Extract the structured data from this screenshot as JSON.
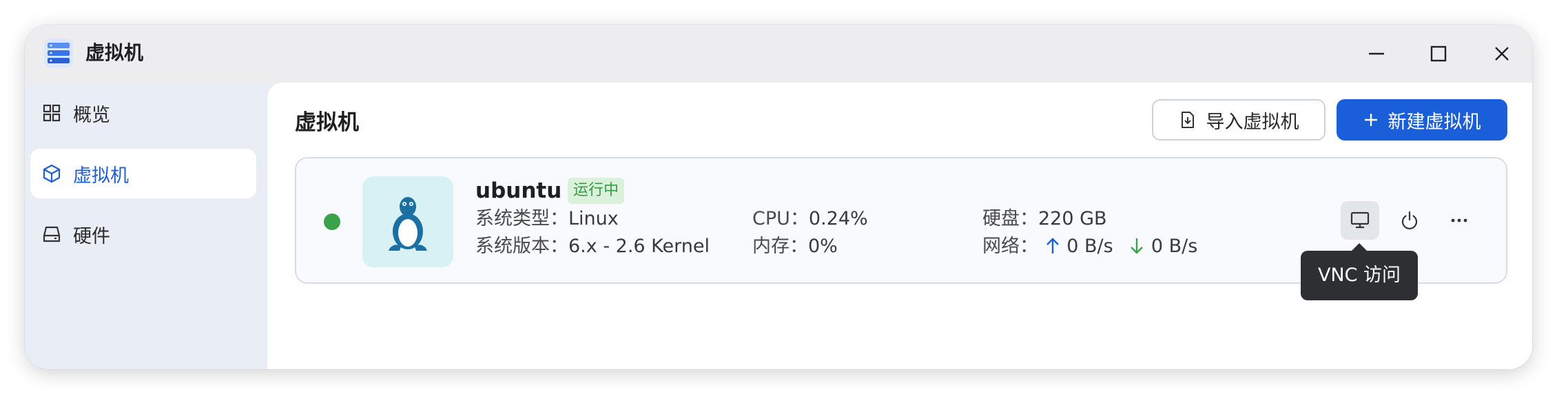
{
  "window": {
    "title": "虚拟机"
  },
  "sidebar": {
    "items": [
      {
        "label": "概览",
        "icon": "grid-icon",
        "active": false
      },
      {
        "label": "虚拟机",
        "icon": "cube-icon",
        "active": true
      },
      {
        "label": "硬件",
        "icon": "drive-icon",
        "active": false
      }
    ]
  },
  "main": {
    "title": "虚拟机",
    "import_label": "导入虚拟机",
    "new_label": "新建虚拟机"
  },
  "vm": {
    "name": "ubuntu",
    "status": "运行中",
    "os_type_key": "系统类型：",
    "os_type": "Linux",
    "os_version_key": "系统版本：",
    "os_version": "6.x - 2.6 Kernel",
    "cpu_key": "CPU：",
    "cpu": "0.24%",
    "mem_key": "内存：",
    "mem": "0%",
    "disk_key": "硬盘：",
    "disk": "220 GB",
    "net_key": "网络：",
    "net_up": "0 B/s",
    "net_down": "0 B/s"
  },
  "tooltip": "VNC 访问",
  "colors": {
    "accent": "#1a5fd9",
    "running": "#3aa34a",
    "badge_bg": "#dcf1dc",
    "up_arrow": "#1a5fd9",
    "down_arrow": "#3aa34a"
  }
}
